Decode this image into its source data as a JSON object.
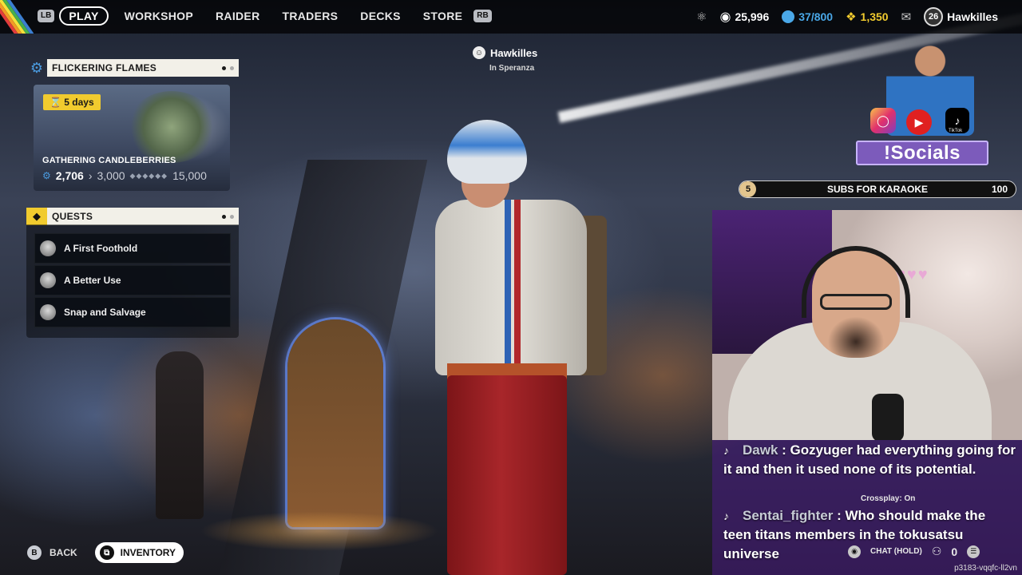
{
  "topbar": {
    "lb": "LB",
    "rb": "RB",
    "tabs": [
      "PLAY",
      "WORKSHOP",
      "RAIDER",
      "TRADERS",
      "DECKS",
      "STORE"
    ],
    "coins": "25,996",
    "cred": "37/800",
    "tokens": "1,350",
    "level": "26",
    "username": "Hawkilles",
    "colors": {
      "cred": "#4aa8e8",
      "tokens": "#f1cb2e"
    }
  },
  "event": {
    "title": "FLICKERING FLAMES",
    "timer": "5 days",
    "name": "GATHERING CANDLEBERRIES",
    "current": "2,706",
    "next": "3,000",
    "max": "15,000"
  },
  "quests": {
    "title": "QUESTS",
    "items": [
      "A First Foothold",
      "A Better Use",
      "Snap and Salvage"
    ]
  },
  "party": {
    "name": "Hawkilles",
    "location": "In Speranza"
  },
  "bottom": {
    "b_key": "B",
    "back": "BACK",
    "inventory": "INVENTORY"
  },
  "overlay": {
    "socials": "!Socials",
    "tiktok_label": "TikTok",
    "goal": {
      "start": "5",
      "label": "SUBS FOR KARAOKE",
      "end": "100",
      "progress": 0.05,
      "fill_color": "#e3c58e"
    },
    "chat": [
      {
        "user": "Dawk",
        "text": "Gozyuger had everything going for it and then it used none of its potential."
      },
      {
        "user": "Sentai_fighter",
        "text": "Who should make the teen titans members in the tokusatsu universe"
      }
    ],
    "crossplay": "Crossplay: On",
    "chat_hold": "CHAT (HOLD)",
    "party_count": "0",
    "id": "p3183-vqqfc-ll2vn"
  }
}
